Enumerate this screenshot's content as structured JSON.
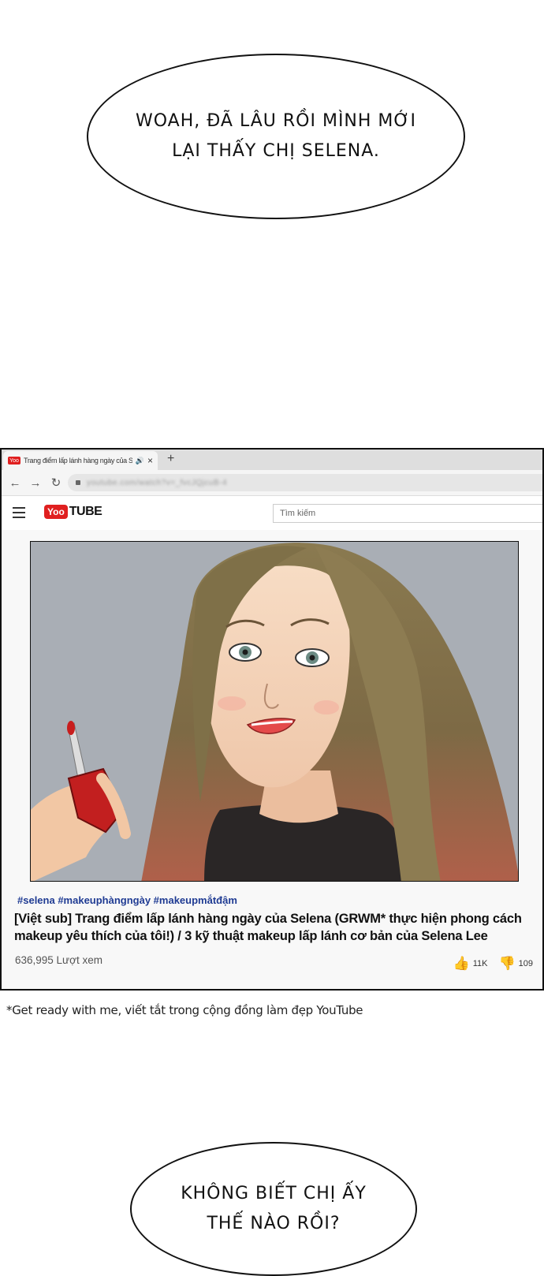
{
  "bubbles": {
    "top": "Woah, đã lâu rồi mình mới\nlại thấy chị Selena.",
    "bottom": "Không biết chị ấy\nthế nào rồi?"
  },
  "browser": {
    "tab": {
      "favicon": "Yoo",
      "title": "Trang điểm lấp lánh hàng ngày của Selena",
      "sound_icon": "speaker-icon",
      "close": "×"
    },
    "new_tab": "+",
    "nav": {
      "back": "←",
      "forward": "→",
      "reload": "↻"
    },
    "url": "youtube.com/watch?v=_fvcJQjcuB-4"
  },
  "youtube": {
    "logo_red": "Yoo",
    "logo_text": "TUBE",
    "search_placeholder": "Tìm kiếm",
    "video": {
      "tags": "#selena #makeuphàngngày #makeupmắtđậm",
      "title": "[Việt sub] Trang điểm lấp lánh hàng ngày của Selena (GRWM* thực hiện phong cách makeup yêu thích của tôi!) / 3 kỹ thuật makeup lấp lánh cơ bản của Selena Lee",
      "views": "636,995 Lượt xem",
      "likes": "11K",
      "dislikes": "109"
    }
  },
  "footnote": "*Get ready with me, viết tắt trong cộng đồng làm đẹp YouTube",
  "colors": {
    "brand_red": "#e01f1f",
    "tag_blue": "#1f3b93"
  }
}
